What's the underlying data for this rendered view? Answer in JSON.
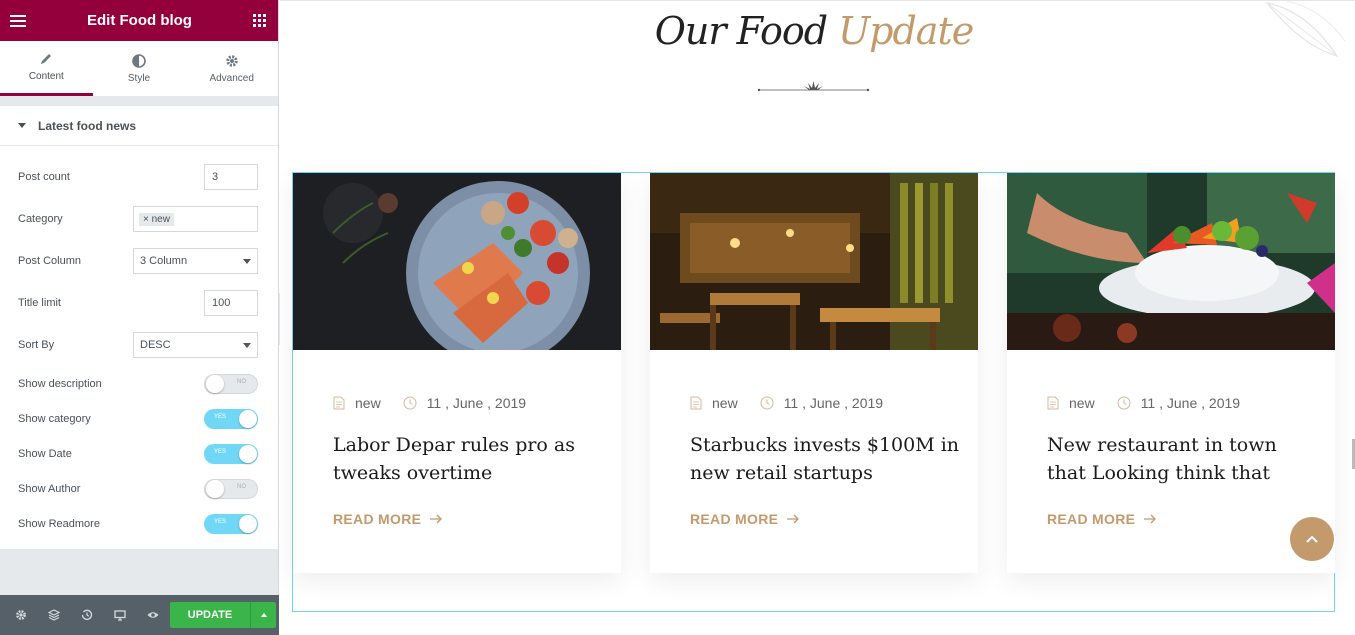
{
  "panel": {
    "title": "Edit Food blog",
    "tabs": [
      {
        "label": "Content",
        "icon": "pencil-icon",
        "active": true
      },
      {
        "label": "Style",
        "icon": "half-circle-icon",
        "active": false
      },
      {
        "label": "Advanced",
        "icon": "gear-icon",
        "active": false
      }
    ],
    "section_title": "Latest food news",
    "controls": {
      "post_count": {
        "label": "Post count",
        "value": "3"
      },
      "category": {
        "label": "Category",
        "tag": "× new"
      },
      "post_column": {
        "label": "Post Column",
        "value": "3 Column"
      },
      "title_limit": {
        "label": "Title limit",
        "value": "100"
      },
      "sort_by": {
        "label": "Sort By",
        "value": "DESC"
      },
      "show_description": {
        "label": "Show description",
        "state": "NO"
      },
      "show_category": {
        "label": "Show category",
        "state": "YES"
      },
      "show_date": {
        "label": "Show Date",
        "state": "YES"
      },
      "show_author": {
        "label": "Show Author",
        "state": "NO"
      },
      "show_readmore": {
        "label": "Show Readmore",
        "state": "YES"
      }
    },
    "footer": {
      "update_label": "UPDATE"
    },
    "colors": {
      "brand": "#93003c",
      "toggle_on": "#71d7f7",
      "update": "#39b54a"
    }
  },
  "preview": {
    "heading_main": "Our Food",
    "heading_accent": "Update",
    "accent_color": "#c49a6c",
    "cards": [
      {
        "category": "new",
        "date": "11 , June , 2019",
        "title": "Labor Depar rules pro as tweaks overtime",
        "readmore": "READ MORE",
        "image": "salmon-plate"
      },
      {
        "category": "new",
        "date": "11 , June , 2019",
        "title": "Starbucks invests $100M in new retail startups",
        "readmore": "READ MORE",
        "image": "restaurant-interior"
      },
      {
        "category": "new",
        "date": "11 , June , 2019",
        "title": "New restaurant in town that Looking think that",
        "readmore": "READ MORE",
        "image": "salad-bowl"
      }
    ]
  }
}
